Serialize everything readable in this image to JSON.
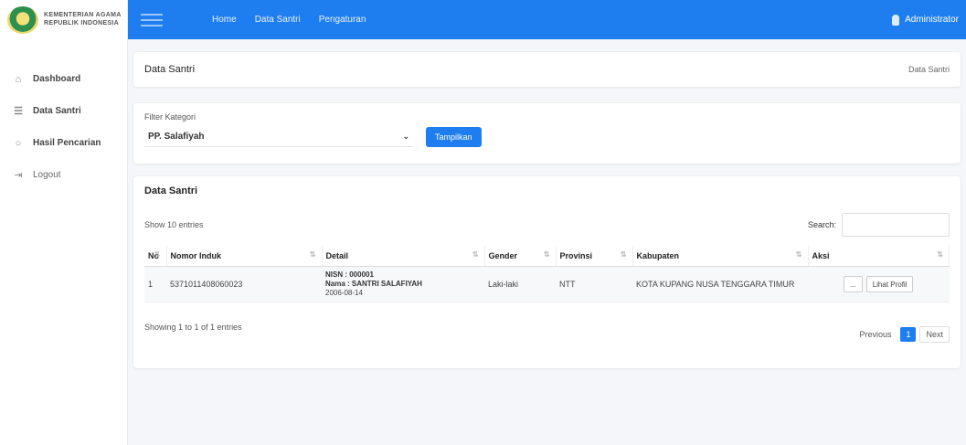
{
  "brand": {
    "line1": "KEMENTERIAN AGAMA",
    "line2": "REPUBLIK INDONESIA"
  },
  "sidebar": {
    "items": [
      {
        "label": "Dashboard",
        "icon": "home-icon"
      },
      {
        "label": "Data Santri",
        "icon": "list-icon"
      },
      {
        "label": "Hasil Pencarian",
        "icon": "search-icon"
      },
      {
        "label": "Logout",
        "icon": "logout-icon"
      }
    ]
  },
  "topbar": {
    "nav": [
      "Home",
      "Data Santri",
      "Pengaturan"
    ],
    "user": "Administrator"
  },
  "page": {
    "title": "Data Santri",
    "breadcrumb": "Data Santri"
  },
  "filter": {
    "label": "Filter Kategori",
    "selected": "PP. Salafiyah",
    "button": "Tampilkan"
  },
  "table": {
    "section_title": "Data Santri",
    "show_entries": "Show 10 entries",
    "search_label": "Search:",
    "search_value": "",
    "columns": [
      "No",
      "Nomor Induk",
      "Detail",
      "Gender",
      "Provinsi",
      "Kabupaten",
      "Aksi"
    ],
    "rows": [
      {
        "no": "1",
        "nomor_induk": "5371011408060023",
        "detail_line1": "NISN : 000001",
        "detail_line2": "Nama : SANTRI SALAFIYAH",
        "detail_line3": "2006-08-14",
        "gender": "Laki-laki",
        "provinsi": "NTT",
        "kabupaten": "KOTA KUPANG NUSA TENGGARA TIMUR",
        "actions": [
          "...",
          "Lihat Profil"
        ]
      }
    ],
    "info": "Showing 1 to 1 of 1 entries",
    "pagination": {
      "prev": "Previous",
      "current": "1",
      "next": "Next"
    }
  }
}
